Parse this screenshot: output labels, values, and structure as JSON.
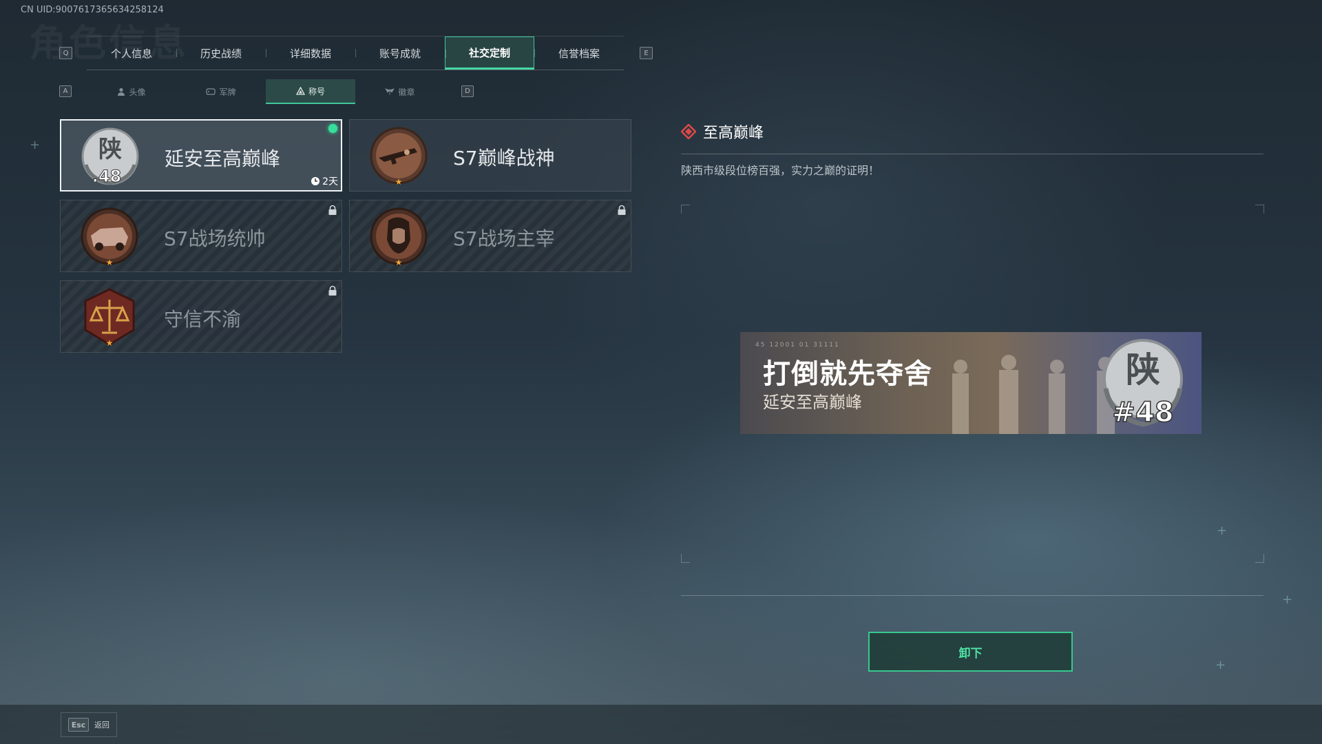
{
  "header": {
    "uid": "CN UID:9007617365634258124",
    "ghost_title": "角色信息"
  },
  "top_tabs": {
    "left_key": "Q",
    "right_key": "E",
    "items": [
      {
        "label": "个人信息"
      },
      {
        "label": "历史战绩"
      },
      {
        "label": "详细数据"
      },
      {
        "label": "账号成就"
      },
      {
        "label": "社交定制",
        "active": true
      },
      {
        "label": "信誉档案"
      }
    ]
  },
  "sub_tabs": {
    "left_key": "A",
    "right_key": "D",
    "items": [
      {
        "label": "头像",
        "icon": "person-icon"
      },
      {
        "label": "军牌",
        "icon": "dogtag-icon"
      },
      {
        "label": "称号",
        "icon": "triangle-icon",
        "active": true
      },
      {
        "label": "徽章",
        "icon": "wings-icon"
      }
    ]
  },
  "titles": [
    {
      "name": "延安至高巅峰",
      "badge": "shaanxi-rank-badge",
      "badge_text": "陕",
      "badge_num": "48",
      "selected": true,
      "equipped": true,
      "timer": "2天"
    },
    {
      "name": "S7巅峰战神",
      "badge": "rifle-badge-icon",
      "locked": false
    },
    {
      "name": "S7战场统帅",
      "badge": "armored-vehicle-badge-icon",
      "locked": true
    },
    {
      "name": "S7战场主宰",
      "badge": "soldier-portrait-badge-icon",
      "locked": true
    },
    {
      "name": "守信不渝",
      "badge": "scales-badge-icon",
      "locked": true
    }
  ],
  "detail": {
    "title": "至高巅峰",
    "description": "陕西市级段位榜百强，实力之巅的证明！",
    "banner": {
      "title": "打倒就先夺舍",
      "subtitle": "延安至高巅峰",
      "code": "45 12001  01 31111",
      "badge_text": "陕",
      "badge_num": "#48"
    },
    "unequip_label": "卸下"
  },
  "footer": {
    "esc_key": "Esc",
    "back_label": "返回"
  },
  "colors": {
    "accent": "#3fc79a",
    "active_dot": "#36e09b",
    "detail_icon": "#e04848"
  }
}
